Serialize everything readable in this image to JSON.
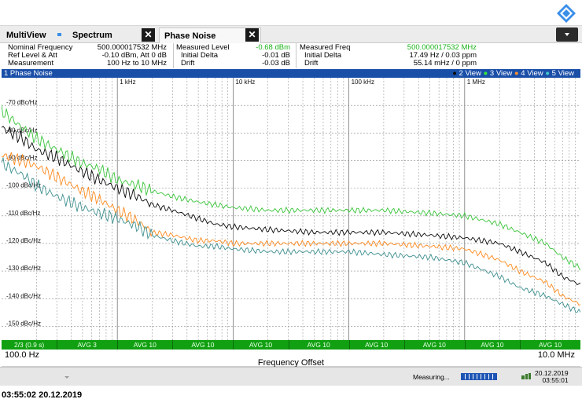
{
  "tabs": {
    "multiview": "MultiView",
    "spectrum": "Spectrum",
    "phase_noise": "Phase Noise",
    "close_glyph": "✕"
  },
  "info": {
    "nominal_frequency_label": "Nominal Frequency",
    "nominal_frequency_value": "500.000017532 MHz",
    "ref_level_label": "Ref Level & Att",
    "ref_level_value": "-0.10 dBm, Att 0 dB",
    "measurement_label": "Measurement",
    "measurement_value": "100 Hz to 10 MHz",
    "measured_level_label": "Measured Level",
    "measured_level_value": "-0.68 dBm",
    "level_initial_delta_label": "Initial Delta",
    "level_initial_delta_value": "-0.01 dB",
    "level_drift_label": "Drift",
    "level_drift_value": "-0.03 dB",
    "measured_freq_label": "Measured Freq",
    "measured_freq_value": "500.000017532 MHz",
    "freq_initial_delta_label": "Initial Delta",
    "freq_initial_delta_value": "17.49 Hz / 0.03 ppm",
    "freq_drift_label": "Drift",
    "freq_drift_value": "55.14 mHz / 0 ppm"
  },
  "phase_bar": {
    "title": "1 Phase Noise",
    "view_icon": "●",
    "view_2": "2 View",
    "view_3": "3 View",
    "view_4": "4 View",
    "view_5": "5 View",
    "bullet": "●"
  },
  "avg_bar": {
    "segments": [
      "2/3 (0.9 s)",
      "AVG 3",
      "AVG 10",
      "AVG 10",
      "AVG 10",
      "AVG 10",
      "AVG 10",
      "AVG 10",
      "AVG 10",
      "AVG 10"
    ]
  },
  "xaxis": {
    "start": "100.0 Hz",
    "stop": "10.0 MHz",
    "title": "Frequency Offset"
  },
  "status": {
    "measuring": "Measuring...",
    "date": "20.12.2019",
    "time": "03:55:01"
  },
  "footer": {
    "timestamp": "03:55:02  20.12.2019"
  },
  "colors": {
    "trace_1": "#0a0a0a",
    "trace_2": "#39c43a",
    "trace_3": "#ff8a1e",
    "trace_4": "#3f8f8f",
    "header_blue": "#1a4fa8",
    "avg_green": "#11a011"
  },
  "chart_data": {
    "type": "line",
    "xscale": "log",
    "xlim": [
      100,
      10000000
    ],
    "ylim": [
      -155,
      -60
    ],
    "grid": true,
    "x_tick_labels": [
      "1 kHz",
      "10 kHz",
      "100 kHz",
      "1 MHz"
    ],
    "y_tick_labels": [
      "-70 dBc/Hz",
      "-80 dBc/Hz",
      "-90 dBc/Hz",
      "-100 dBc/Hz",
      "-110 dBc/Hz",
      "-120 dBc/Hz",
      "-130 dBc/Hz",
      "-140 dBc/Hz",
      "-150 dBc/Hz"
    ],
    "series": [
      {
        "color": "#0a0a0a",
        "x": [
          100,
          150,
          200,
          300,
          500,
          700,
          1000,
          1500,
          2000,
          3000,
          5000,
          7000,
          10000,
          20000,
          50000,
          100000,
          200000,
          500000,
          1000000,
          2000000,
          3000000,
          5000000,
          7000000,
          10000000
        ],
        "y": [
          -78,
          -82,
          -86,
          -89,
          -94,
          -97,
          -100,
          -103,
          -106,
          -108,
          -111,
          -113,
          -114,
          -115,
          -116,
          -116,
          -116,
          -117,
          -118,
          -120,
          -123,
          -127,
          -132,
          -135
        ]
      },
      {
        "color": "#39c43a",
        "x": [
          100,
          150,
          200,
          300,
          500,
          700,
          1000,
          1500,
          2000,
          3000,
          5000,
          7000,
          10000,
          20000,
          50000,
          100000,
          200000,
          500000,
          1000000,
          2000000,
          3000000,
          5000000,
          7000000,
          10000000
        ],
        "y": [
          -72,
          -78,
          -82,
          -86,
          -91,
          -93,
          -97,
          -99,
          -101,
          -103,
          -105,
          -106,
          -107,
          -108,
          -108,
          -108,
          -108,
          -109,
          -110,
          -113,
          -116,
          -120,
          -125,
          -129
        ]
      },
      {
        "color": "#ff8a1e",
        "x": [
          100,
          150,
          200,
          300,
          500,
          700,
          1000,
          1500,
          2000,
          3000,
          5000,
          7000,
          10000,
          20000,
          50000,
          100000,
          200000,
          500000,
          1000000,
          2000000,
          3000000,
          5000000,
          7000000,
          10000000
        ],
        "y": [
          -88,
          -90,
          -92,
          -96,
          -101,
          -104,
          -108,
          -112,
          -116,
          -117,
          -119,
          -119,
          -120,
          -120,
          -120,
          -120,
          -120,
          -121,
          -122,
          -126,
          -130,
          -134,
          -139,
          -142
        ]
      },
      {
        "color": "#3f8f8f",
        "x": [
          100,
          150,
          200,
          300,
          500,
          700,
          1000,
          1500,
          2000,
          3000,
          5000,
          7000,
          10000,
          20000,
          50000,
          100000,
          200000,
          500000,
          1000000,
          2000000,
          3000000,
          5000000,
          7000000,
          10000000
        ],
        "y": [
          -91,
          -95,
          -99,
          -103,
          -107,
          -109,
          -111,
          -114,
          -117,
          -119,
          -121,
          -121,
          -122,
          -123,
          -123,
          -123,
          -124,
          -125,
          -127,
          -132,
          -136,
          -139,
          -142,
          -145
        ]
      }
    ]
  }
}
